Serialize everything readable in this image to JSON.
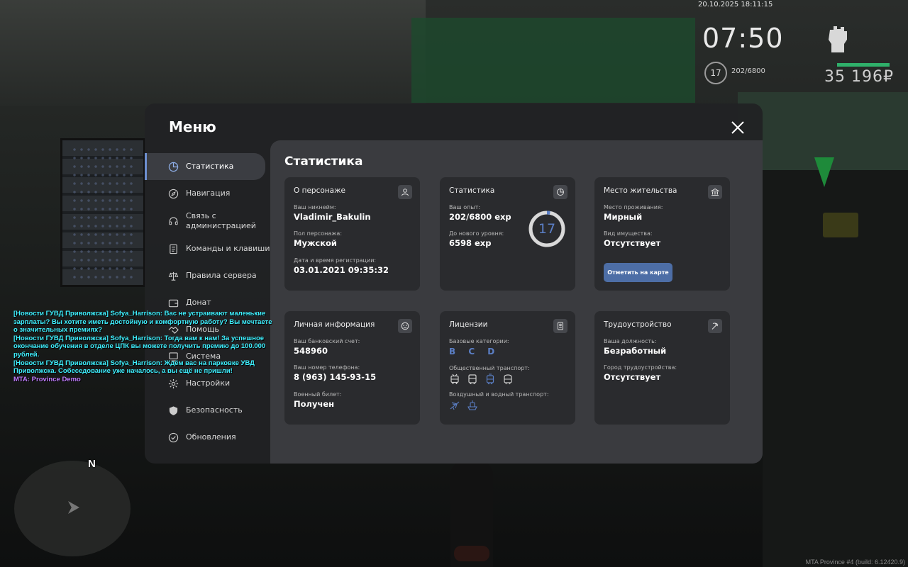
{
  "hud": {
    "datetime": "20.10.2025 18:11:15",
    "time": "07:50",
    "level": "17",
    "exp": "202/6800",
    "money": "35 196₽",
    "health_fraction": 1.0
  },
  "chat": [
    {
      "text": "[Новости ГУВД Приволжска] Sofya_Harrison: Вас не устраивают маленькие зарплаты? Вы хотите иметь достойную и комфортную работу? Вы мечтаете о значительных премиях?"
    },
    {
      "text": "[Новости ГУВД Приволжска] Sofya_Harrison: Тогда вам к нам! За успешное окончание обучения в отделе ЦПК вы можете получить премию до 100.000 рублей."
    },
    {
      "text": "[Новости ГУВД Приволжска] Sofya_Harrison: Ждём вас на парковке УВД Приволжска. Собеседование уже началось, а вы ещё не пришли!"
    },
    {
      "text": "MTA: Province Demo"
    }
  ],
  "minimap": {
    "north": "N"
  },
  "build": "MTA Province #4 (build: 6.12420.9)",
  "menu": {
    "title": "Меню",
    "sidebar": [
      {
        "label": "Статистика",
        "icon": "pie-chart-icon"
      },
      {
        "label": "Навигация",
        "icon": "compass-icon"
      },
      {
        "label": "Связь с администрацией",
        "icon": "headset-icon"
      },
      {
        "label": "Команды и клавиши",
        "icon": "document-icon"
      },
      {
        "label": "Правила сервера",
        "icon": "scales-icon"
      },
      {
        "label": "Донат",
        "icon": "wallet-icon"
      },
      {
        "label": "Помощь",
        "icon": "handshake-icon"
      },
      {
        "label": "Система",
        "icon": "system-icon"
      },
      {
        "label": "Настройки",
        "icon": "gear-icon"
      },
      {
        "label": "Безопасность",
        "icon": "shield-icon"
      },
      {
        "label": "Обновления",
        "icon": "check-icon"
      }
    ],
    "content_title": "Статистика",
    "cards": {
      "character": {
        "title": "О персонаже",
        "nick_label": "Ваш никнейм:",
        "nick": "Vladimir_Bakulin",
        "gender_label": "Пол персонажа:",
        "gender": "Мужской",
        "reg_label": "Дата и время регистрации:",
        "reg": "03.01.2021 09:35:32"
      },
      "stats": {
        "title": "Статистика",
        "exp_label": "Ваш опыт:",
        "exp": "202/6800 exp",
        "next_label": "До нового уровня:",
        "next": "6598 exp",
        "level": "17",
        "progress_fraction": 0.03
      },
      "residence": {
        "title": "Место жительства",
        "place_label": "Место проживания:",
        "place": "Мирный",
        "property_label": "Вид имущества:",
        "property": "Отсутствует",
        "button": "Отметить на карте"
      },
      "personal": {
        "title": "Личная информация",
        "bank_label": "Ваш банковский счет:",
        "bank": "548960",
        "phone_label": "Ваш номер телефона:",
        "phone": "8 (963) 145-93-15",
        "military_label": "Военный билет:",
        "military": "Получен"
      },
      "licenses": {
        "title": "Лицензии",
        "base_label": "Базовые категории:",
        "base": "B C D",
        "public_label": "Общественный транспорт:",
        "air_label": "Воздушный и водный транспорт:"
      },
      "employment": {
        "title": "Трудоустройство",
        "position_label": "Ваша должность:",
        "position": "Безработный",
        "city_label": "Город трудоустройства:",
        "city": "Отсутствует"
      }
    }
  },
  "colors": {
    "accent": "#5b7fc6",
    "button": "#4d6ea6",
    "chat": "#3ef0ff",
    "mta": "#c07cff"
  }
}
